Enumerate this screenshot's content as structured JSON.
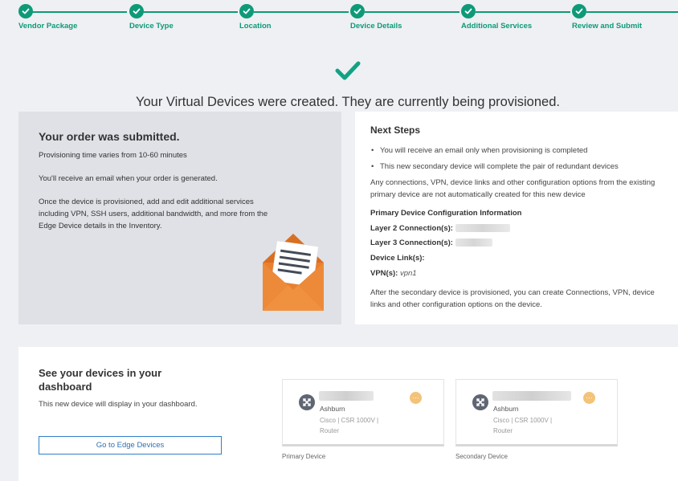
{
  "stepper": {
    "steps": [
      {
        "label": "Vendor Package"
      },
      {
        "label": "Device Type"
      },
      {
        "label": "Location"
      },
      {
        "label": "Device Details"
      },
      {
        "label": "Additional Services"
      },
      {
        "label": "Review and Submit"
      }
    ]
  },
  "hero": {
    "title": "Your Virtual Devices were created. They are currently being provisioned."
  },
  "order": {
    "title": "Your order was submitted.",
    "p1": "Provisioning time varies from 10-60 minutes",
    "p2": "You'll receive an email when your order is generated.",
    "p3": "Once the device is provisioned, add and edit additional services including VPN, SSH users, additional bandwidth, and more from the Edge Device details in the Inventory."
  },
  "next_steps": {
    "title": "Next Steps",
    "bullets": [
      "You will receive an email only when provisioning is completed",
      "This new secondary device will complete the pair of redundant devices"
    ],
    "note": "Any connections, VPN, device links and other configuration options from the existing primary device are not automatically created for this new device",
    "config_title": "Primary Device Configuration Information",
    "layer2_label": "Layer 2 Connection(s):",
    "layer3_label": "Layer 3 Connection(s):",
    "device_links_label": "Device Link(s):",
    "vpn_label": "VPN(s):",
    "vpn_value": "vpn1",
    "after": "After the secondary device is provisioned, you can create Connections, VPN, device links and other configuration options on the device."
  },
  "dashboard": {
    "title": "See your devices in your dashboard",
    "subtitle": "This new device will display in your dashboard.",
    "button": "Go to Edge Devices",
    "devices": [
      {
        "location": "Ashburn",
        "model": "Cisco | CSR 1000V | Router",
        "caption": "Primary Device",
        "status": "···"
      },
      {
        "location": "Ashburn",
        "model": "Cisco | CSR 1000V | Router",
        "caption": "Secondary Device",
        "status": "···"
      }
    ]
  },
  "colors": {
    "accent": "#0e9a78",
    "envelope": "#e8802f",
    "link": "#2f7fc9",
    "status_pending": "#f3c37a"
  }
}
